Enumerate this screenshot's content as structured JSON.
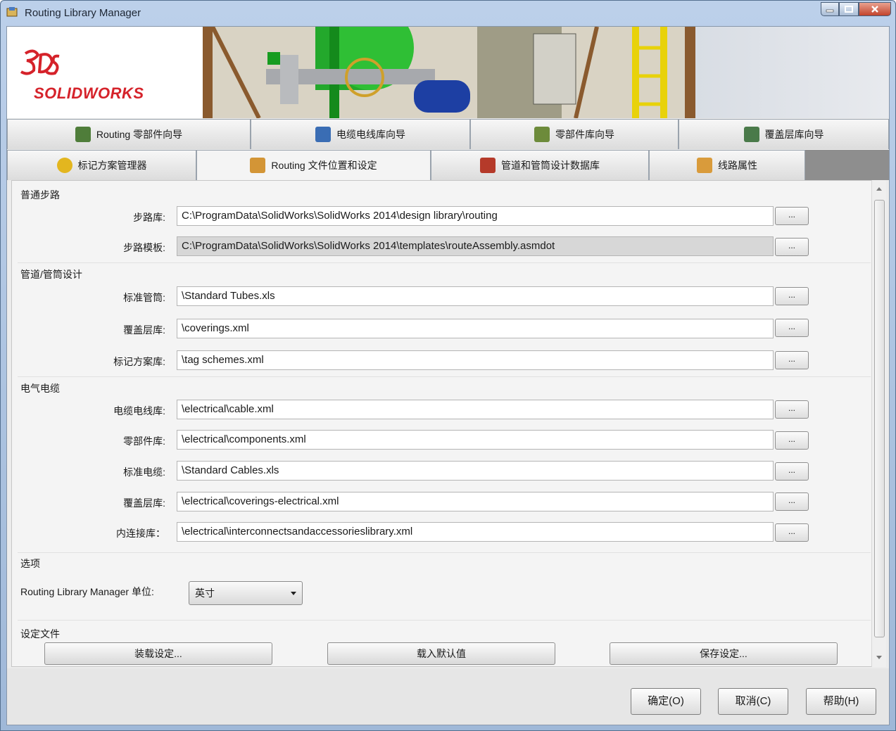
{
  "window": {
    "title": "Routing Library Manager"
  },
  "banner": {
    "logo_text": "SOLIDWORKS"
  },
  "tabs_row1": [
    {
      "label": "Routing 零部件向导"
    },
    {
      "label": "电缆电线库向导"
    },
    {
      "label": "零部件库向导"
    },
    {
      "label": "覆盖层库向导"
    }
  ],
  "tabs_row2": [
    {
      "label": "标记方案管理器"
    },
    {
      "label": "Routing 文件位置和设定",
      "active": true
    },
    {
      "label": "管道和管筒设计数据库"
    },
    {
      "label": "线路属性"
    }
  ],
  "sections": {
    "general": "普通步路",
    "pipe": "管道/管筒设计",
    "electrical": "电气电缆",
    "options": "选项",
    "settings_file": "设定文件"
  },
  "rows": {
    "routing_lib": {
      "label": "步路库:",
      "value": "C:\\ProgramData\\SolidWorks\\SolidWorks 2014\\design library\\routing"
    },
    "routing_template": {
      "label": "步路模板:",
      "value": "C:\\ProgramData\\SolidWorks\\SolidWorks 2014\\templates\\routeAssembly.asmdot"
    },
    "std_tubes": {
      "label": "标准管筒:",
      "value": "\\Standard Tubes.xls"
    },
    "coverings": {
      "label": "覆盖层库:",
      "value": "\\coverings.xml"
    },
    "tag_schemes": {
      "label": "标记方案库:",
      "value": "\\tag schemes.xml"
    },
    "cable_lib": {
      "label": "电缆电线库:",
      "value": "\\electrical\\cable.xml"
    },
    "components": {
      "label": "零部件库:",
      "value": "\\electrical\\components.xml"
    },
    "std_cables": {
      "label": "标准电缆:",
      "value": "\\Standard Cables.xls"
    },
    "coverings_elec": {
      "label": "覆盖层库:",
      "value": "\\electrical\\coverings-electrical.xml"
    },
    "interconnect": {
      "label": "内连接库：",
      "value": "\\electrical\\interconnectsandaccessorieslibrary.xml"
    }
  },
  "browse_label": "...",
  "options": {
    "units_label": "Routing Library Manager 单位:",
    "units_value": "英寸"
  },
  "settings_buttons": {
    "load": "装载设定...",
    "defaults": "载入默认值",
    "save": "保存设定..."
  },
  "footer": {
    "ok": "确定(O)",
    "cancel": "取消(C)",
    "help": "帮助(H)"
  },
  "colors": {
    "brand_red": "#d5222a",
    "title_gradient": "#bcd0ea",
    "close_red": "#c2432c"
  }
}
